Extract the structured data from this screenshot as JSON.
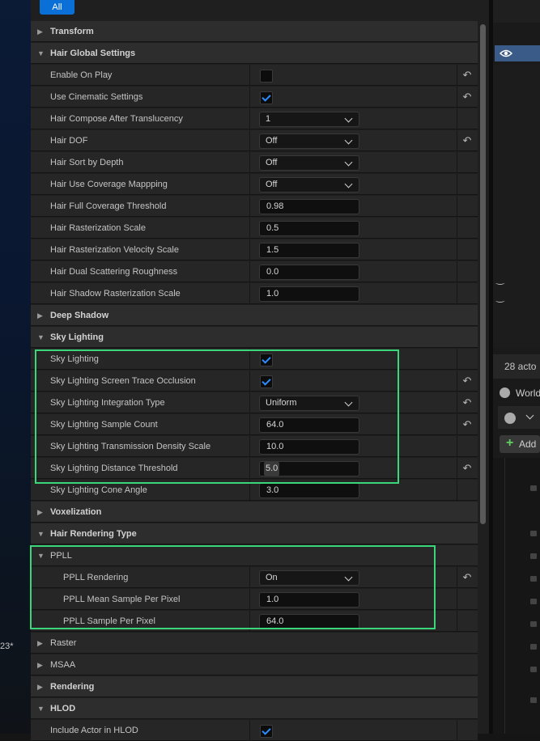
{
  "toolbar": {
    "all_label": "All"
  },
  "left_note": "23*",
  "rows": [
    {
      "type": "cat",
      "label": "Transform",
      "expanded": false
    },
    {
      "type": "cat",
      "label": "Hair Global Settings",
      "expanded": true
    },
    {
      "type": "check",
      "label": "Enable On Play",
      "checked": false,
      "reset": true
    },
    {
      "type": "check",
      "label": "Use Cinematic Settings",
      "checked": true,
      "reset": true
    },
    {
      "type": "dropdown",
      "label": "Hair Compose After Translucency",
      "value": "1",
      "reset": false
    },
    {
      "type": "dropdown",
      "label": "Hair DOF",
      "value": "Off",
      "reset": true
    },
    {
      "type": "dropdown",
      "label": "Hair Sort by Depth",
      "value": "Off",
      "reset": false
    },
    {
      "type": "dropdown",
      "label": "Hair Use Coverage Mappping",
      "value": "Off",
      "reset": false
    },
    {
      "type": "input",
      "label": "Hair Full Coverage Threshold",
      "value": "0.98",
      "reset": false
    },
    {
      "type": "input",
      "label": "Hair Rasterization Scale",
      "value": "0.5",
      "reset": false
    },
    {
      "type": "input",
      "label": "Hair Rasterization Velocity Scale",
      "value": "1.5",
      "reset": false
    },
    {
      "type": "input",
      "label": "Hair Dual Scattering Roughness",
      "value": "0.0",
      "reset": false
    },
    {
      "type": "input",
      "label": "Hair Shadow Rasterization Scale",
      "value": "1.0",
      "reset": false
    },
    {
      "type": "cat",
      "label": "Deep Shadow",
      "expanded": false
    },
    {
      "type": "cat",
      "label": "Sky Lighting",
      "expanded": true
    },
    {
      "type": "check",
      "label": "Sky Lighting",
      "checked": true,
      "reset": false
    },
    {
      "type": "check",
      "label": "Sky Lighting Screen Trace Occlusion",
      "checked": true,
      "reset": true
    },
    {
      "type": "dropdown",
      "label": "Sky Lighting Integration Type",
      "value": "Uniform",
      "reset": true
    },
    {
      "type": "input",
      "label": "Sky Lighting Sample Count",
      "value": "64.0",
      "reset": true
    },
    {
      "type": "input",
      "label": "Sky Lighting Transmission Density Scale",
      "value": "10.0",
      "reset": false
    },
    {
      "type": "input",
      "label": "Sky Lighting Distance Threshold",
      "value": "5.0",
      "reset": true,
      "scrub": true
    },
    {
      "type": "input",
      "label": "Sky Lighting Cone Angle",
      "value": "3.0",
      "reset": false
    },
    {
      "type": "cat",
      "label": "Voxelization",
      "expanded": false
    },
    {
      "type": "cat",
      "label": "Hair Rendering Type",
      "expanded": true
    },
    {
      "type": "subcat",
      "label": "PPLL",
      "expanded": true
    },
    {
      "type": "dropdown",
      "label": "PPLL Rendering",
      "value": "On",
      "reset": true,
      "indent": true
    },
    {
      "type": "input",
      "label": "PPLL Mean Sample Per Pixel",
      "value": "1.0",
      "reset": false,
      "indent": true
    },
    {
      "type": "input",
      "label": "PPLL Sample Per Pixel",
      "value": "64.0",
      "reset": false,
      "indent": true
    },
    {
      "type": "subcat",
      "label": "Raster",
      "expanded": false
    },
    {
      "type": "subcat",
      "label": "MSAA",
      "expanded": false
    },
    {
      "type": "cat",
      "label": "Rendering",
      "expanded": false
    },
    {
      "type": "cat",
      "label": "HLOD",
      "expanded": true
    },
    {
      "type": "check",
      "label": "Include Actor in HLOD",
      "checked": true,
      "reset": false
    }
  ],
  "right_panel": {
    "actor_count": "28 acto",
    "world_label": "World",
    "add_label": "Add"
  }
}
